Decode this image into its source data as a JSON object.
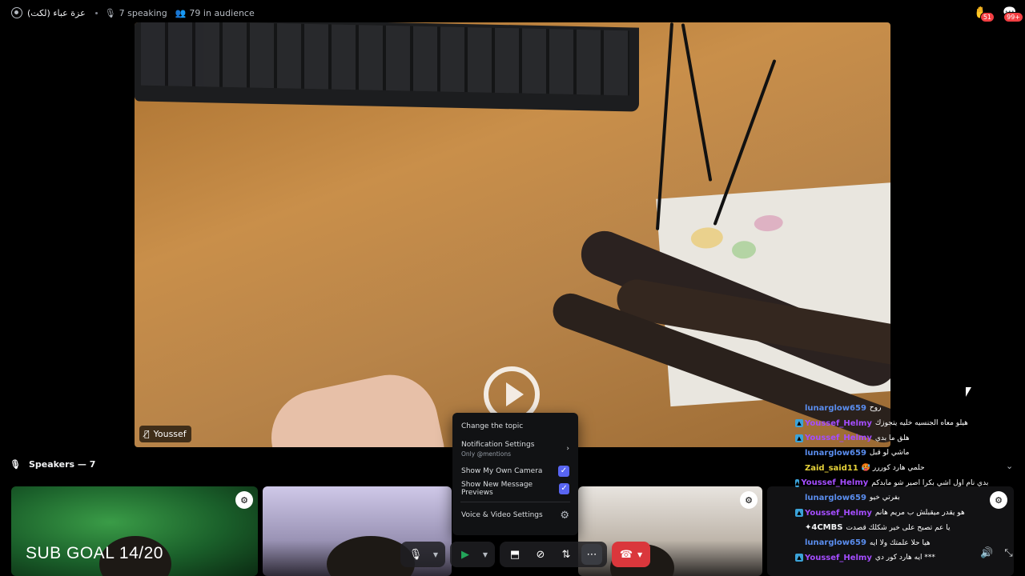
{
  "topbar": {
    "stage_title": "(لكت) عزة عباء",
    "speaking": "7 speaking",
    "audience": "79 in audience",
    "hand_badge": "51",
    "messages_badge": "99+"
  },
  "stage": {
    "presenter_name": "Youssef"
  },
  "speakers": {
    "header": "Speakers — 7"
  },
  "overlay": {
    "sub_goal": "SUB GOAL 14/20"
  },
  "menu": {
    "change_topic": "Change the topic",
    "notification_settings": "Notification Settings",
    "notification_sub": "Only @mentions",
    "show_camera": "Show My Own Camera",
    "show_previews": "Show New Message Previews",
    "voice_video": "Voice & Video Settings"
  },
  "chat": [
    {
      "user": "lunarglow659",
      "color": "#5a8dee",
      "badge": false,
      "text": "روح"
    },
    {
      "user": "Youssef_Helmy",
      "color": "#a44dff",
      "badge": true,
      "text": "هيلو معاه الجنسيه خليه يتجوزك"
    },
    {
      "user": "Youssef_Helmy",
      "color": "#a44dff",
      "badge": true,
      "text": "هلق ما بدي"
    },
    {
      "user": "lunarglow659",
      "color": "#5a8dee",
      "badge": false,
      "text": "ماشي لو قبل"
    },
    {
      "user": "Zaid_said11",
      "color": "#e6d23a",
      "badge": false,
      "text": "🥵 حلمي هارد كوررر"
    },
    {
      "user": "Youssef_Helmy",
      "color": "#a44dff",
      "badge": true,
      "text": "بدي نام اول اشي بكرا اصير شو مابدكم"
    },
    {
      "user": "lunarglow659",
      "color": "#5a8dee",
      "badge": false,
      "text": "بفرتي خيو"
    },
    {
      "user": "Youssef_Helmy",
      "color": "#a44dff",
      "badge": true,
      "text": "هو يقدر ميقبلش ب مريم هانم"
    },
    {
      "user": "✦4CMBS",
      "color": "#f2f3f5",
      "badge": false,
      "text": "يا عم تصبح على خير شكلك قصدت"
    },
    {
      "user": "lunarglow659",
      "color": "#5a8dee",
      "badge": false,
      "text": "هيا حلا علمتك ولا ايه"
    },
    {
      "user": "Youssef_Helmy",
      "color": "#a44dff",
      "badge": true,
      "text": "ايه هارد كور دي ***"
    }
  ]
}
